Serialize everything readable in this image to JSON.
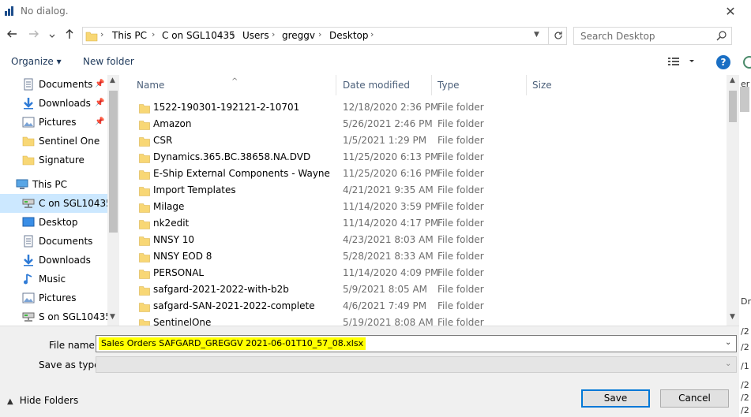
{
  "window": {
    "title": "No dialog.",
    "close_label": "✕"
  },
  "nav": {
    "back_icon": "back-arrow-icon",
    "forward_icon": "forward-arrow-icon",
    "recent_icon": "chevron-down-icon",
    "up_icon": "up-arrow-icon"
  },
  "address": {
    "breadcrumbs": [
      "This PC",
      "C on SGL10435",
      "Users",
      "greggv",
      "Desktop"
    ],
    "refresh_icon": "refresh-icon"
  },
  "search": {
    "placeholder": "Search Desktop"
  },
  "toolbar": {
    "organize_label": "Organize ▾",
    "new_folder_label": "New folder",
    "help_label": "?"
  },
  "sidebar": {
    "items": [
      {
        "label": "Documents",
        "icon": "documents-icon",
        "pinned": true
      },
      {
        "label": "Downloads",
        "icon": "downloads-icon",
        "pinned": true
      },
      {
        "label": "Pictures",
        "icon": "pictures-icon",
        "pinned": true
      },
      {
        "label": "Sentinel One",
        "icon": "folder-icon",
        "pinned": false
      },
      {
        "label": "Signature",
        "icon": "folder-icon",
        "pinned": false
      },
      {
        "label": "This PC",
        "icon": "computer-icon",
        "pinned": false
      },
      {
        "label": "C on SGL10435",
        "icon": "network-drive-icon",
        "pinned": false,
        "selected": true
      },
      {
        "label": "Desktop",
        "icon": "desktop-icon",
        "pinned": false
      },
      {
        "label": "Documents",
        "icon": "documents-icon",
        "pinned": false
      },
      {
        "label": "Downloads",
        "icon": "downloads-icon",
        "pinned": false
      },
      {
        "label": "Music",
        "icon": "music-icon",
        "pinned": false
      },
      {
        "label": "Pictures",
        "icon": "pictures-icon",
        "pinned": false
      },
      {
        "label": "S on SGL10435",
        "icon": "network-drive-icon",
        "pinned": false
      }
    ]
  },
  "columns": {
    "name": "Name",
    "date_modified": "Date modified",
    "type": "Type",
    "size": "Size"
  },
  "files": [
    {
      "name": "1522-190301-192121-2-10701",
      "date": "12/18/2020 2:36 PM",
      "type": "File folder"
    },
    {
      "name": "Amazon",
      "date": "5/26/2021 2:46 PM",
      "type": "File folder"
    },
    {
      "name": "CSR",
      "date": "1/5/2021 1:29 PM",
      "type": "File folder"
    },
    {
      "name": "Dynamics.365.BC.38658.NA.DVD",
      "date": "11/25/2020 6:13 PM",
      "type": "File folder"
    },
    {
      "name": "E-Ship External Components - Wayne",
      "date": "11/25/2020 6:16 PM",
      "type": "File folder"
    },
    {
      "name": "Import Templates",
      "date": "4/21/2021 9:35 AM",
      "type": "File folder"
    },
    {
      "name": "Milage",
      "date": "11/14/2020 3:59 PM",
      "type": "File folder"
    },
    {
      "name": "nk2edit",
      "date": "11/14/2020 4:17 PM",
      "type": "File folder"
    },
    {
      "name": "NNSY 10",
      "date": "4/23/2021 8:03 AM",
      "type": "File folder"
    },
    {
      "name": "NNSY EOD 8",
      "date": "5/28/2021 8:33 AM",
      "type": "File folder"
    },
    {
      "name": "PERSONAL",
      "date": "11/14/2020 4:09 PM",
      "type": "File folder"
    },
    {
      "name": "safgard-2021-2022-with-b2b",
      "date": "5/9/2021 8:05 AM",
      "type": "File folder"
    },
    {
      "name": "safgard-SAN-2021-2022-complete",
      "date": "4/6/2021 7:49 PM",
      "type": "File folder"
    },
    {
      "name": "SentinelOne",
      "date": "5/19/2021 8:08 AM",
      "type": "File folder"
    }
  ],
  "save": {
    "file_name_label": "File name:",
    "file_name_value": "Sales Orders SAFGARD_GREGGV 2021-06-01T10_57_08.xlsx",
    "save_as_type_label": "Save as type:",
    "save_as_type_value": "",
    "hide_folders_label": "Hide Folders",
    "save_button": "Save",
    "cancel_button": "Cancel"
  },
  "background_fragments": [
    "er",
    "Dr",
    "/2",
    "/2",
    "/1",
    "/1",
    "/2",
    "/2",
    "/2"
  ],
  "colors": {
    "accent": "#0078d7",
    "selection": "#cce8ff",
    "highlight": "#ffff00",
    "folder": "#f8d775"
  }
}
